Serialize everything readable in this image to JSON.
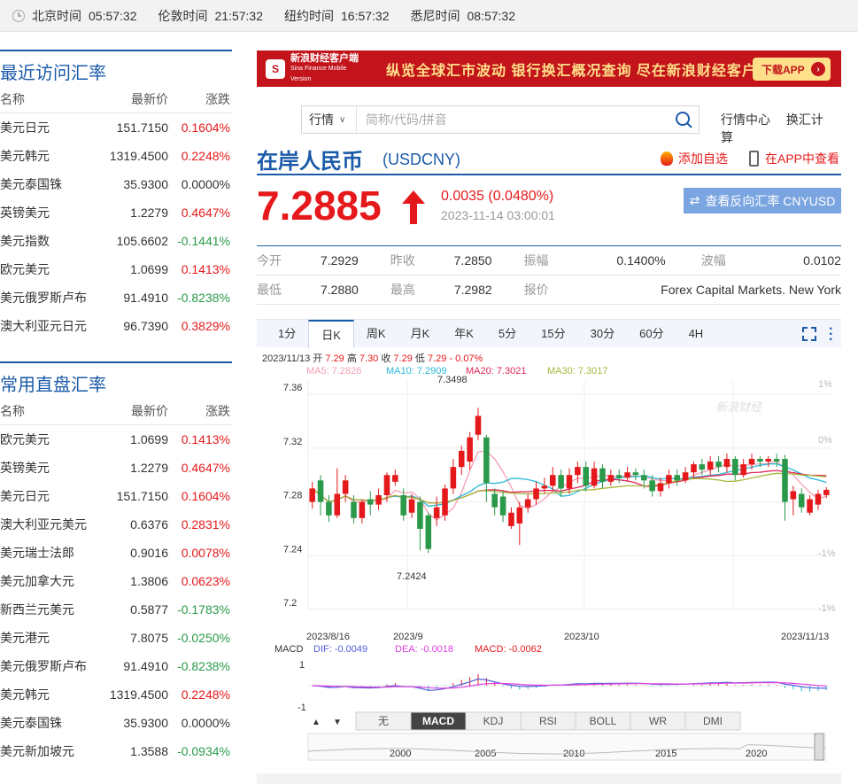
{
  "timezones": [
    {
      "name": "北京时间",
      "time": "05:57:32"
    },
    {
      "name": "伦敦时间",
      "time": "21:57:32"
    },
    {
      "name": "纽约时间",
      "time": "16:57:32"
    },
    {
      "name": "悉尼时间",
      "time": "08:57:32"
    }
  ],
  "recent": {
    "title": "最近访问汇率",
    "headers": [
      "名称",
      "最新价",
      "涨跌"
    ],
    "rows": [
      {
        "name": "美元日元",
        "price": "151.7150",
        "chg": "0.1604%",
        "dir": "up"
      },
      {
        "name": "美元韩元",
        "price": "1319.4500",
        "chg": "0.2248%",
        "dir": "up"
      },
      {
        "name": "美元泰国铢",
        "price": "35.9300",
        "chg": "0.0000%",
        "dir": "flat"
      },
      {
        "name": "英镑美元",
        "price": "1.2279",
        "chg": "0.4647%",
        "dir": "up"
      },
      {
        "name": "美元指数",
        "price": "105.6602",
        "chg": "-0.1441%",
        "dir": "down"
      },
      {
        "name": "欧元美元",
        "price": "1.0699",
        "chg": "0.1413%",
        "dir": "up"
      },
      {
        "name": "美元俄罗斯卢布",
        "price": "91.4910",
        "chg": "-0.8238%",
        "dir": "down"
      },
      {
        "name": "澳大利亚元日元",
        "price": "96.7390",
        "chg": "0.3829%",
        "dir": "up"
      }
    ]
  },
  "direct": {
    "title": "常用直盘汇率",
    "headers": [
      "名称",
      "最新价",
      "涨跌"
    ],
    "rows": [
      {
        "name": "欧元美元",
        "price": "1.0699",
        "chg": "0.1413%",
        "dir": "up"
      },
      {
        "name": "英镑美元",
        "price": "1.2279",
        "chg": "0.4647%",
        "dir": "up"
      },
      {
        "name": "美元日元",
        "price": "151.7150",
        "chg": "0.1604%",
        "dir": "up"
      },
      {
        "name": "澳大利亚元美元",
        "price": "0.6376",
        "chg": "0.2831%",
        "dir": "up"
      },
      {
        "name": "美元瑞士法郎",
        "price": "0.9016",
        "chg": "0.0078%",
        "dir": "up"
      },
      {
        "name": "美元加拿大元",
        "price": "1.3806",
        "chg": "0.0623%",
        "dir": "up"
      },
      {
        "name": "新西兰元美元",
        "price": "0.5877",
        "chg": "-0.1783%",
        "dir": "down"
      },
      {
        "name": "美元港元",
        "price": "7.8075",
        "chg": "-0.0250%",
        "dir": "down"
      },
      {
        "name": "美元俄罗斯卢布",
        "price": "91.4910",
        "chg": "-0.8238%",
        "dir": "down"
      },
      {
        "name": "美元韩元",
        "price": "1319.4500",
        "chg": "0.2248%",
        "dir": "up"
      },
      {
        "name": "美元泰国铢",
        "price": "35.9300",
        "chg": "0.0000%",
        "dir": "flat"
      },
      {
        "name": "美元新加坡元",
        "price": "1.3588",
        "chg": "-0.0934%",
        "dir": "down"
      }
    ]
  },
  "banner": {
    "brand": "新浪财经客户端",
    "brand_en": "Sina Finance Mobile Version",
    "slogan": "纵览全球汇市波动  银行换汇概况查询  尽在新浪财经客户端",
    "download": "下载APP"
  },
  "search": {
    "select": "行情",
    "placeholder": "简称/代码/拼音"
  },
  "toplinks": [
    "行情中心",
    "换汇计算"
  ],
  "header": {
    "name": "在岸人民币",
    "code": "(USDCNY)",
    "add_fav": "添加自选",
    "view_app": "在APP中查看",
    "price": "7.2885",
    "change": "0.0035 (0.0480%)",
    "timestamp": "2023-11-14 03:00:01",
    "reverse_btn": "查看反向汇率 CNYUSD"
  },
  "quote": [
    [
      {
        "k": "今开",
        "v": "7.2929"
      },
      {
        "k": "昨收",
        "v": "7.2850"
      },
      {
        "k": "振幅",
        "v": "0.1400%"
      },
      {
        "k": "波幅",
        "v": "0.0102"
      }
    ],
    [
      {
        "k": "最低",
        "v": "7.2880"
      },
      {
        "k": "最高",
        "v": "7.2982"
      },
      {
        "k": "报价",
        "v": "Forex Capital Markets. New York"
      }
    ]
  ],
  "ktabs": [
    "1分",
    "日K",
    "周K",
    "月K",
    "年K",
    "5分",
    "15分",
    "30分",
    "60分",
    "4H"
  ],
  "ktab_active": 1,
  "chart_info": {
    "date": "2023/11/13",
    "o_label": "开",
    "o": "7.29",
    "h_label": "高",
    "h": "7.30",
    "c_label": "收",
    "c": "7.29",
    "l_label": "低",
    "l": "7.29",
    "pct": "- 0.07%",
    "ma5": "MA5: 7.2826",
    "ma10": "MA10: 7.2909",
    "ma20": "MA20: 7.3021",
    "ma30": "MA30: 7.3017",
    "watermark": "新浪财经",
    "macd_label": "MACD",
    "dif": "DIF: -0.0049",
    "dea": "DEA: -0.0018",
    "macd": "MACD: -0.0062"
  },
  "indicator_tabs": [
    "无",
    "MACD",
    "KDJ",
    "RSI",
    "BOLL",
    "WR",
    "DMI"
  ],
  "indicator_active": 1,
  "timeline_years": [
    "2000",
    "2005",
    "2010",
    "2015",
    "2020"
  ],
  "colors": {
    "up": "#e5191b",
    "down": "#2a9a4a",
    "ma5": "#f4a0b5",
    "ma10": "#27b8d8",
    "ma20": "#e0245a",
    "ma30": "#a8b83a",
    "dif": "#5060d8",
    "dea": "#e040e0"
  },
  "chart_data": {
    "type": "candlestick",
    "x_labels": [
      "2023/8/16",
      "2023/9",
      "2023/10",
      "2023/11/13"
    ],
    "y_ticks": [
      7.2,
      7.24,
      7.28,
      7.32,
      7.36
    ],
    "ylim": [
      7.2,
      7.37
    ],
    "right_ticks": [
      "1%",
      "0%",
      "-1%",
      "-1%"
    ],
    "high_annotation": "7.3498",
    "low_annotation": "7.2424",
    "macd_ticks": [
      "1",
      "-1"
    ],
    "candles": [
      {
        "o": 7.28,
        "c": 7.29,
        "h": 7.295,
        "l": 7.275
      },
      {
        "o": 7.296,
        "c": 7.28,
        "h": 7.3,
        "l": 7.27
      },
      {
        "o": 7.28,
        "c": 7.27,
        "h": 7.285,
        "l": 7.265
      },
      {
        "o": 7.27,
        "c": 7.286,
        "h": 7.305,
        "l": 7.268
      },
      {
        "o": 7.286,
        "c": 7.296,
        "h": 7.3,
        "l": 7.28
      },
      {
        "o": 7.28,
        "c": 7.268,
        "h": 7.285,
        "l": 7.264
      },
      {
        "o": 7.268,
        "c": 7.28,
        "h": 7.282,
        "l": 7.264
      },
      {
        "o": 7.282,
        "c": 7.278,
        "h": 7.288,
        "l": 7.27
      },
      {
        "o": 7.278,
        "c": 7.285,
        "h": 7.29,
        "l": 7.274
      },
      {
        "o": 7.285,
        "c": 7.3,
        "h": 7.302,
        "l": 7.28
      },
      {
        "o": 7.295,
        "c": 7.3,
        "h": 7.304,
        "l": 7.292
      },
      {
        "o": 7.285,
        "c": 7.27,
        "h": 7.29,
        "l": 7.266
      },
      {
        "o": 7.272,
        "c": 7.282,
        "h": 7.286,
        "l": 7.268
      },
      {
        "o": 7.28,
        "c": 7.26,
        "h": 7.284,
        "l": 7.244
      },
      {
        "o": 7.27,
        "c": 7.245,
        "h": 7.272,
        "l": 7.242
      },
      {
        "o": 7.268,
        "c": 7.276,
        "h": 7.284,
        "l": 7.262
      },
      {
        "o": 7.27,
        "c": 7.29,
        "h": 7.293,
        "l": 7.266
      },
      {
        "o": 7.29,
        "c": 7.306,
        "h": 7.312,
        "l": 7.286
      },
      {
        "o": 7.306,
        "c": 7.318,
        "h": 7.322,
        "l": 7.3
      },
      {
        "o": 7.31,
        "c": 7.328,
        "h": 7.332,
        "l": 7.304
      },
      {
        "o": 7.33,
        "c": 7.344,
        "h": 7.35,
        "l": 7.326
      },
      {
        "o": 7.328,
        "c": 7.294,
        "h": 7.33,
        "l": 7.28
      },
      {
        "o": 7.286,
        "c": 7.276,
        "h": 7.29,
        "l": 7.27
      },
      {
        "o": 7.284,
        "c": 7.27,
        "h": 7.288,
        "l": 7.265
      },
      {
        "o": 7.262,
        "c": 7.272,
        "h": 7.276,
        "l": 7.26
      },
      {
        "o": 7.264,
        "c": 7.276,
        "h": 7.28,
        "l": 7.248
      },
      {
        "o": 7.276,
        "c": 7.282,
        "h": 7.286,
        "l": 7.272
      },
      {
        "o": 7.282,
        "c": 7.29,
        "h": 7.295,
        "l": 7.278
      },
      {
        "o": 7.29,
        "c": 7.292,
        "h": 7.298,
        "l": 7.286
      },
      {
        "o": 7.292,
        "c": 7.3,
        "h": 7.306,
        "l": 7.288
      },
      {
        "o": 7.3,
        "c": 7.29,
        "h": 7.304,
        "l": 7.284
      },
      {
        "o": 7.29,
        "c": 7.3,
        "h": 7.305,
        "l": 7.286
      },
      {
        "o": 7.3,
        "c": 7.306,
        "h": 7.31,
        "l": 7.294
      },
      {
        "o": 7.306,
        "c": 7.292,
        "h": 7.31,
        "l": 7.288
      },
      {
        "o": 7.292,
        "c": 7.305,
        "h": 7.31,
        "l": 7.29
      },
      {
        "o": 7.305,
        "c": 7.295,
        "h": 7.308,
        "l": 7.29
      },
      {
        "o": 7.295,
        "c": 7.3,
        "h": 7.304,
        "l": 7.292
      },
      {
        "o": 7.3,
        "c": 7.298,
        "h": 7.304,
        "l": 7.294
      },
      {
        "o": 7.298,
        "c": 7.302,
        "h": 7.306,
        "l": 7.295
      },
      {
        "o": 7.302,
        "c": 7.3,
        "h": 7.305,
        "l": 7.296
      },
      {
        "o": 7.3,
        "c": 7.296,
        "h": 7.304,
        "l": 7.29
      },
      {
        "o": 7.296,
        "c": 7.288,
        "h": 7.3,
        "l": 7.284
      },
      {
        "o": 7.288,
        "c": 7.294,
        "h": 7.298,
        "l": 7.284
      },
      {
        "o": 7.294,
        "c": 7.3,
        "h": 7.304,
        "l": 7.29
      },
      {
        "o": 7.3,
        "c": 7.296,
        "h": 7.304,
        "l": 7.292
      },
      {
        "o": 7.296,
        "c": 7.302,
        "h": 7.306,
        "l": 7.294
      },
      {
        "o": 7.302,
        "c": 7.308,
        "h": 7.31,
        "l": 7.298
      },
      {
        "o": 7.308,
        "c": 7.304,
        "h": 7.312,
        "l": 7.3
      },
      {
        "o": 7.304,
        "c": 7.31,
        "h": 7.314,
        "l": 7.3
      },
      {
        "o": 7.31,
        "c": 7.306,
        "h": 7.314,
        "l": 7.302
      },
      {
        "o": 7.306,
        "c": 7.312,
        "h": 7.316,
        "l": 7.302
      },
      {
        "o": 7.312,
        "c": 7.3,
        "h": 7.314,
        "l": 7.296
      },
      {
        "o": 7.3,
        "c": 7.308,
        "h": 7.312,
        "l": 7.298
      },
      {
        "o": 7.308,
        "c": 7.312,
        "h": 7.316,
        "l": 7.304
      },
      {
        "o": 7.312,
        "c": 7.31,
        "h": 7.314,
        "l": 7.306
      },
      {
        "o": 7.31,
        "c": 7.312,
        "h": 7.314,
        "l": 7.306
      },
      {
        "o": 7.312,
        "c": 7.31,
        "h": 7.316,
        "l": 7.306
      },
      {
        "o": 7.312,
        "c": 7.28,
        "h": 7.315,
        "l": 7.266
      },
      {
        "o": 7.282,
        "c": 7.288,
        "h": 7.292,
        "l": 7.27
      },
      {
        "o": 7.286,
        "c": 7.276,
        "h": 7.29,
        "l": 7.272
      },
      {
        "o": 7.272,
        "c": 7.282,
        "h": 7.285,
        "l": 7.27
      },
      {
        "o": 7.278,
        "c": 7.286,
        "h": 7.289,
        "l": 7.274
      },
      {
        "o": 7.285,
        "c": 7.289,
        "h": 7.291,
        "l": 7.283
      }
    ]
  }
}
